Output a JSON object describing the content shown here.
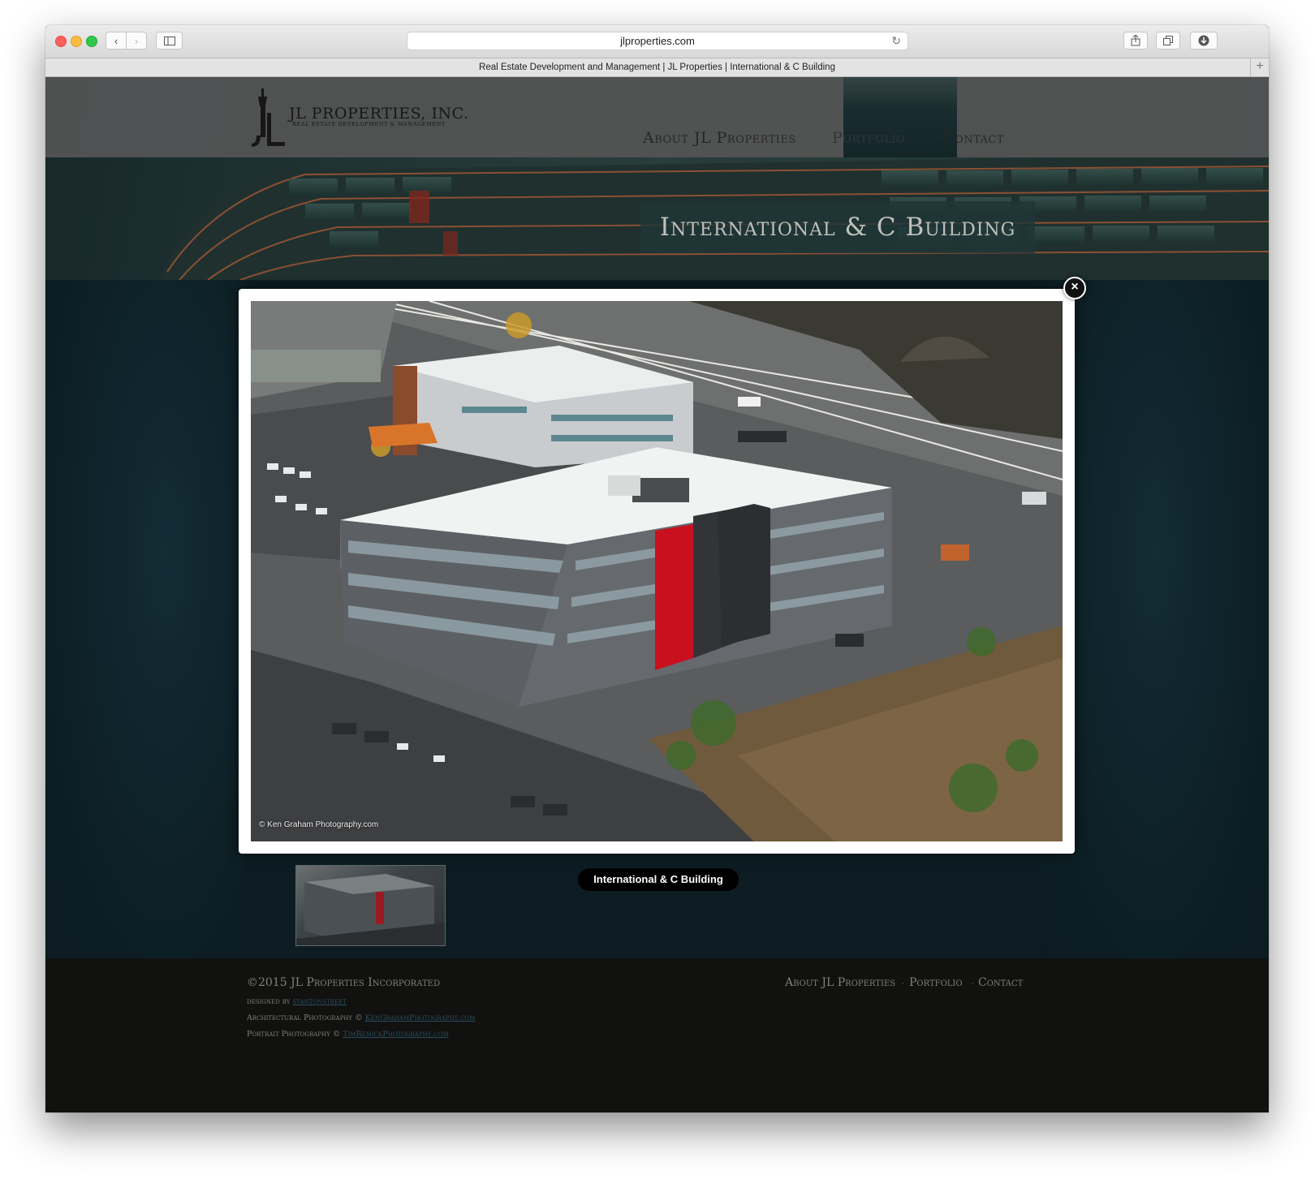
{
  "browser": {
    "url": "jlproperties.com",
    "tab_title": "Real Estate Development and Management | JL Properties | International & C Building",
    "new_tab_label": "+"
  },
  "site": {
    "logo_name": "JL PROPERTIES, INC.",
    "logo_tagline": "REAL ESTATE DEVELOPMENT & MANAGEMENT",
    "nav": {
      "about": "About JL Properties",
      "portfolio": "Portfolio",
      "contact": "Contact"
    },
    "page_title": "International & C Building"
  },
  "lightbox": {
    "caption": "International & C Building",
    "photo_credit": "© Ken Graham Photography.com",
    "close_label": "×"
  },
  "footer": {
    "copyright": "©2015 JL Properties Incorporated",
    "designed_by_label": "designed by",
    "designed_by_link": "stantonstreet",
    "arch_photo_label": "Architectural Photography ©",
    "arch_photo_link": "KenGrahamPhotography.com",
    "portrait_photo_label": "Portrait Photography ©",
    "portrait_photo_link": "TimRemickPhotography.com",
    "nav": {
      "about": "About JL Properties",
      "portfolio": "Portfolio",
      "contact": "Contact"
    },
    "separator": "·"
  },
  "colors": {
    "accent_red": "#c8101e",
    "header_gray": "#5f5f5f",
    "content_teal": "#0e2027",
    "footer_black": "#131312"
  }
}
